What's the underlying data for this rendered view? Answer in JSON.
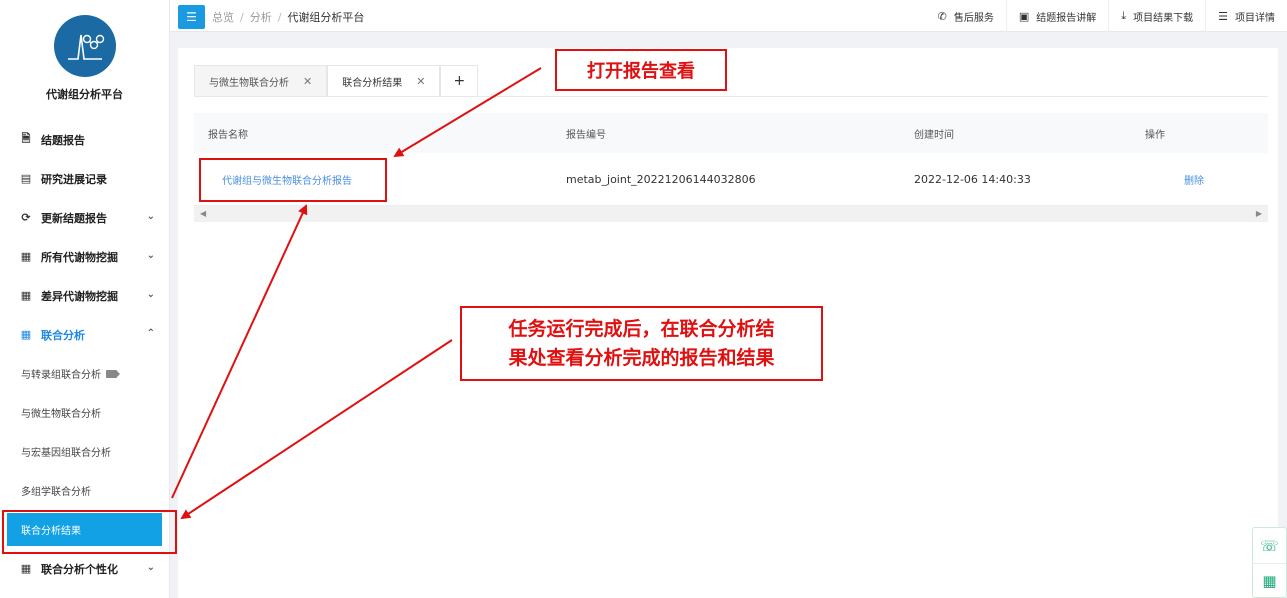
{
  "brand": {
    "name": "代谢组分析平台"
  },
  "sidebar": {
    "items": [
      {
        "label": "结题报告",
        "icon": "document-icon"
      },
      {
        "label": "研究进展记录",
        "icon": "chart-icon"
      },
      {
        "label": "更新结题报告",
        "icon": "refresh-icon",
        "chevron": "down"
      },
      {
        "label": "所有代谢物挖掘",
        "icon": "grid-icon",
        "chevron": "down"
      },
      {
        "label": "差异代谢物挖掘",
        "icon": "grid-icon",
        "chevron": "down"
      },
      {
        "label": "联合分析",
        "icon": "grid-icon",
        "chevron": "up"
      }
    ],
    "sub_items": [
      {
        "label": "与转录组联合分析"
      },
      {
        "label": "与微生物联合分析"
      },
      {
        "label": "与宏基因组联合分析"
      },
      {
        "label": "多组学联合分析"
      },
      {
        "label": "联合分析结果"
      }
    ],
    "last_item": {
      "label": "联合分析个性化",
      "icon": "grid-icon"
    }
  },
  "breadcrumb": {
    "home": "总览",
    "section": "分析",
    "current": "代谢组分析平台"
  },
  "top_actions": [
    {
      "label": "售后服务",
      "icon": "phone-icon"
    },
    {
      "label": "结题报告讲解",
      "icon": "video-icon"
    },
    {
      "label": "项目结果下载",
      "icon": "download-icon"
    },
    {
      "label": "项目详情",
      "icon": "list-icon"
    }
  ],
  "tabs": [
    {
      "label": "与微生物联合分析"
    },
    {
      "label": "联合分析结果"
    }
  ],
  "table": {
    "headers": [
      "报告名称",
      "报告编号",
      "创建时间",
      "操作"
    ],
    "rows": [
      {
        "name": "代谢组与微生物联合分析报告",
        "id": "metab_joint_20221206144032806",
        "time": "2022-12-06 14:40:33",
        "action": "删除"
      }
    ]
  },
  "annotations": {
    "top": "打开报告查看",
    "mid_line1": "任务运行完成后，在联合分析结",
    "mid_line2": "果处查看分析完成的报告和结果"
  },
  "colors": {
    "accent": "#11a1e4",
    "annotation": "#e01010",
    "link": "#4a8fe2"
  }
}
